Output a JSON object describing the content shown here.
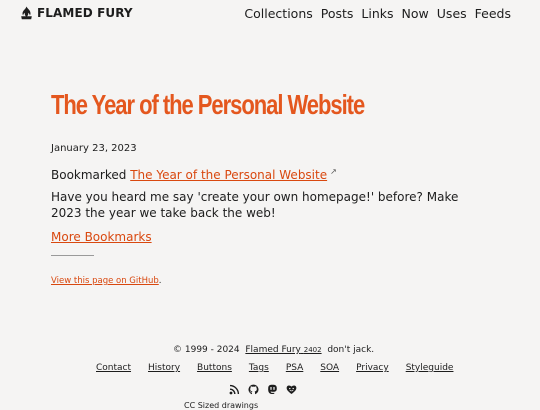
{
  "site": {
    "name": "FLAMED FURY"
  },
  "nav": [
    "Collections",
    "Posts",
    "Links",
    "Now",
    "Uses",
    "Feeds"
  ],
  "post": {
    "title": "The Year of the Personal Website",
    "date": "January 23, 2023",
    "bookmarked_prefix": "Bookmarked",
    "bookmarked_link": "The Year of the Personal Website",
    "external_marker": "↗",
    "body": "Have you heard me say 'create your own homepage!' before? Make 2023 the year we take back the web!",
    "more_link": "More Bookmarks",
    "github_link": "View this page on GitHub",
    "github_suffix": "."
  },
  "footer": {
    "copyright": "© 1999 - 2024",
    "site_link": "Flamed Fury",
    "version": "2402",
    "tagline": "don't jack.",
    "links": [
      "Contact",
      "History",
      "Buttons",
      "Tags",
      "PSA",
      "SOA",
      "Privacy",
      "Styleguide"
    ],
    "icons": [
      "rss-icon",
      "github-icon",
      "mastodon-icon",
      "heart-face-icon"
    ],
    "cc_text": "CC Sized drawings"
  },
  "colors": {
    "accent": "#e4571e",
    "link": "#d9480f",
    "background": "#f5f4f3",
    "text": "#1d1d1d"
  }
}
